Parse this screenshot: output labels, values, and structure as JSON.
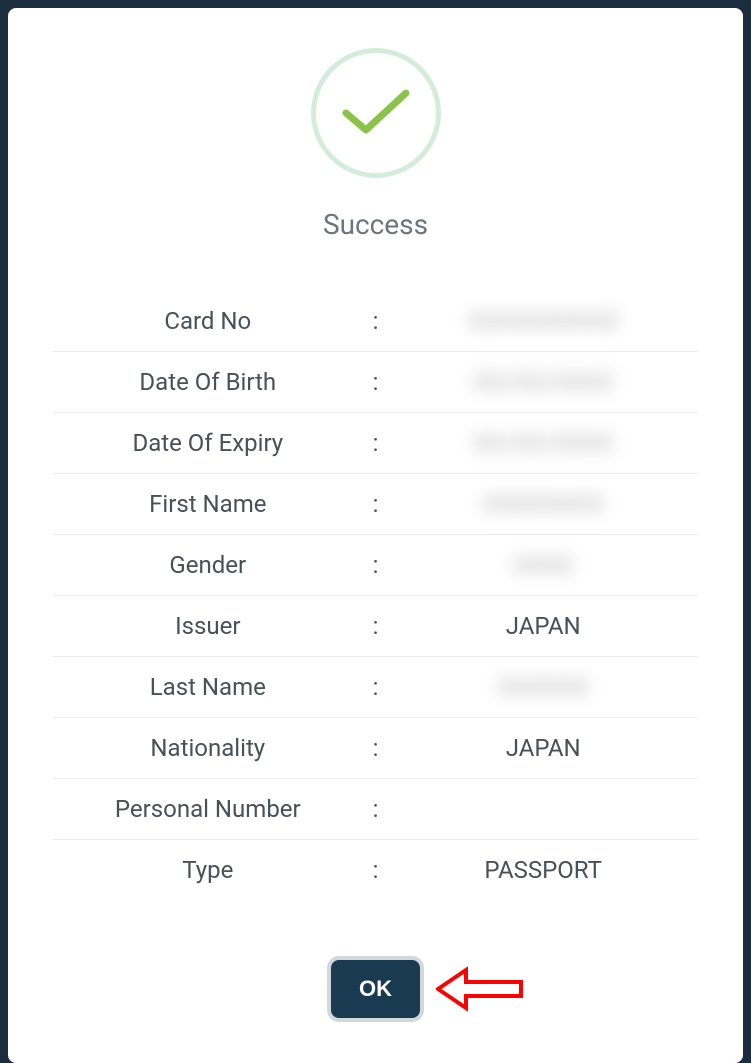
{
  "modal": {
    "title": "Success",
    "ok_button_label": "OK",
    "fields": [
      {
        "label": "Card No",
        "value": "XXXXXXXXXX",
        "blurred": true
      },
      {
        "label": "Date Of Birth",
        "value": "XX/XX/XXXX",
        "blurred": true
      },
      {
        "label": "Date Of Expiry",
        "value": "XX/XX/XXXX",
        "blurred": true
      },
      {
        "label": "First Name",
        "value": "XXXXXXXX",
        "blurred": true
      },
      {
        "label": "Gender",
        "value": "XXXX",
        "blurred": true
      },
      {
        "label": "Issuer",
        "value": "JAPAN",
        "blurred": false
      },
      {
        "label": "Last Name",
        "value": "XXXXXX",
        "blurred": true
      },
      {
        "label": "Nationality",
        "value": "JAPAN",
        "blurred": false
      },
      {
        "label": "Personal Number",
        "value": "",
        "blurred": false
      },
      {
        "label": "Type",
        "value": "PASSPORT",
        "blurred": false
      }
    ]
  }
}
